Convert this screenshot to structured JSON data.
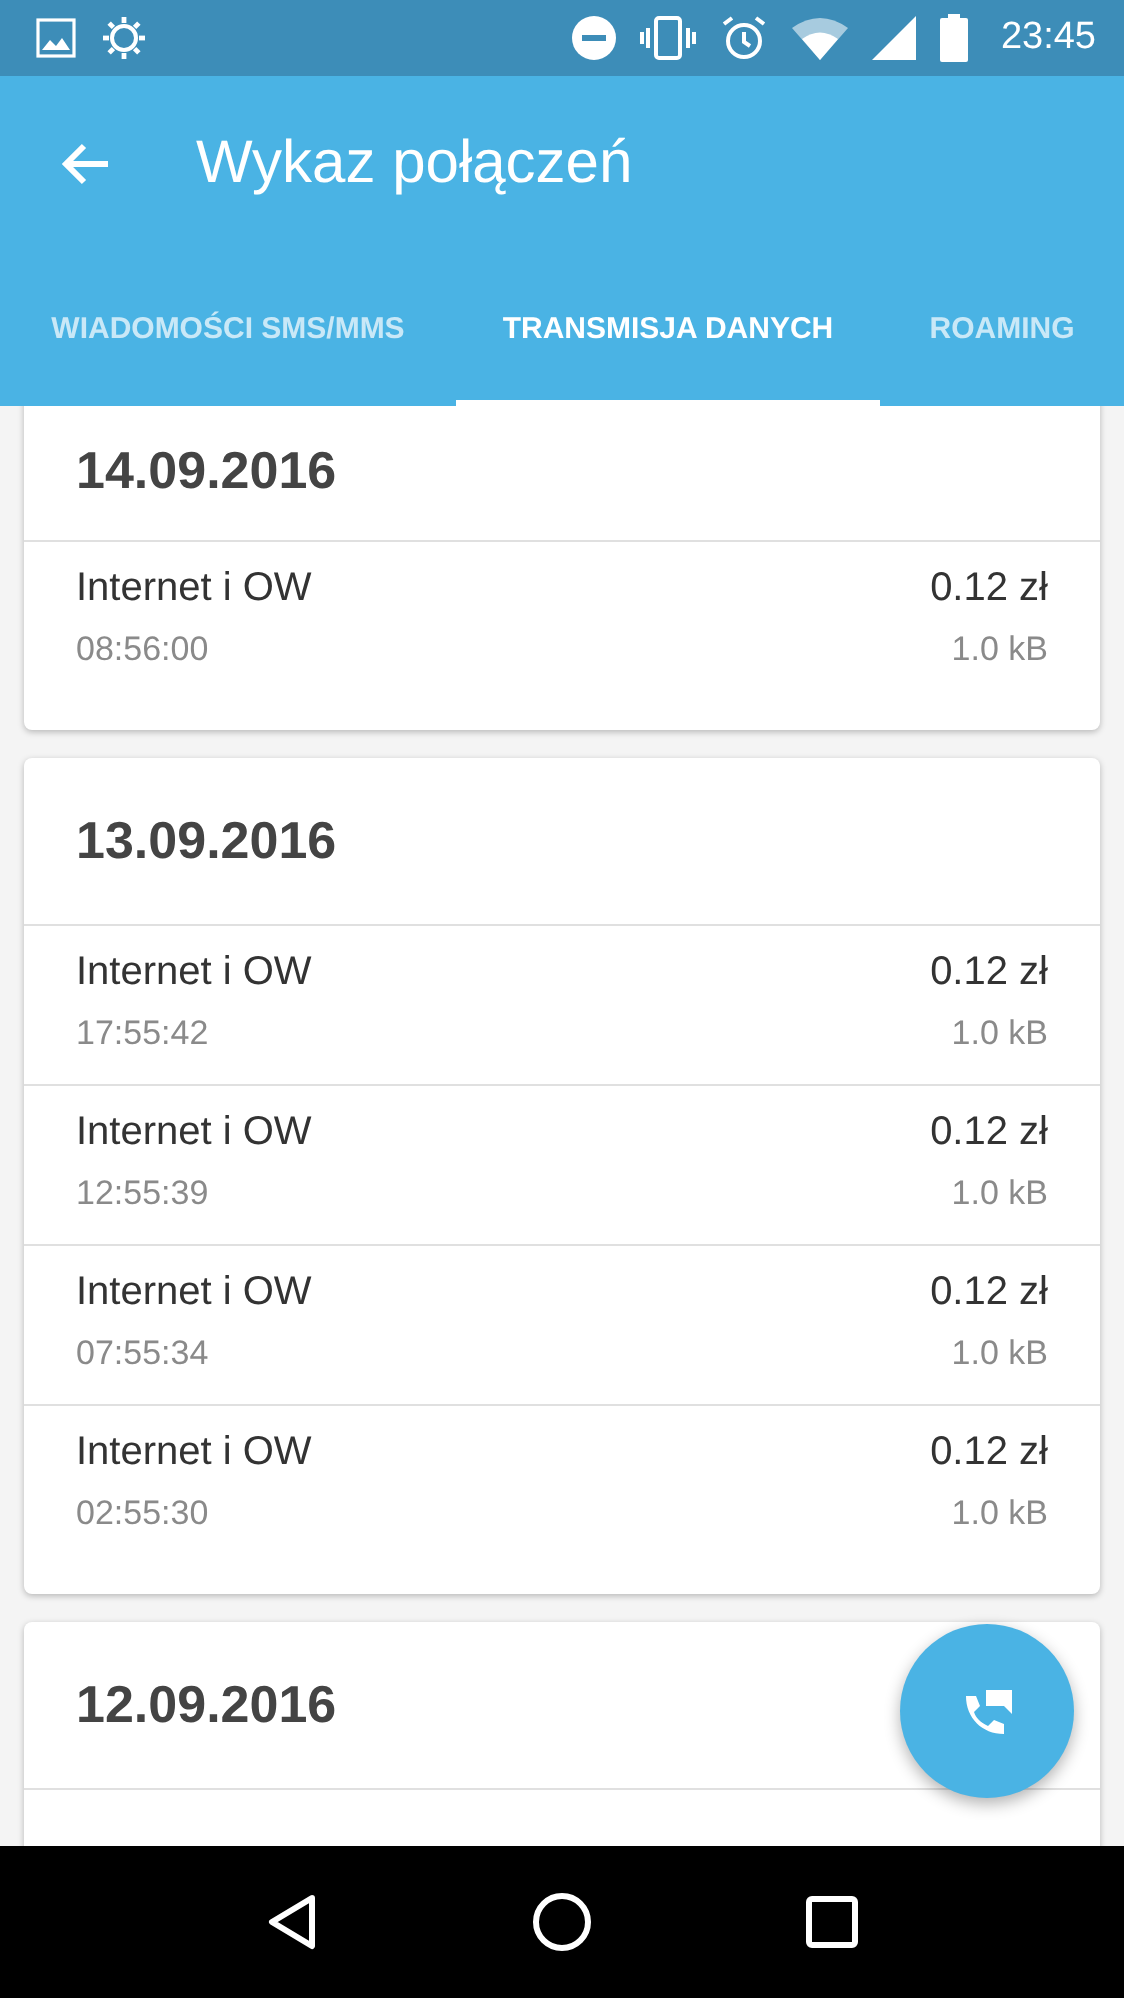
{
  "status_bar": {
    "time": "23:45"
  },
  "app_bar": {
    "title": "Wykaz połączeń"
  },
  "tabs": [
    {
      "label": "WIADOMOŚCI SMS/MMS",
      "selected": false
    },
    {
      "label": "TRANSMISJA DANYCH",
      "selected": true
    },
    {
      "label": "ROAMING",
      "selected": false
    }
  ],
  "days": [
    {
      "date": "14.09.2016",
      "entries": [
        {
          "name": "Internet i OW",
          "time": "08:56:00",
          "amount": "0.12 zł",
          "volume": "1.0 kB"
        }
      ]
    },
    {
      "date": "13.09.2016",
      "entries": [
        {
          "name": "Internet i OW",
          "time": "17:55:42",
          "amount": "0.12 zł",
          "volume": "1.0 kB"
        },
        {
          "name": "Internet i OW",
          "time": "12:55:39",
          "amount": "0.12 zł",
          "volume": "1.0 kB"
        },
        {
          "name": "Internet i OW",
          "time": "07:55:34",
          "amount": "0.12 zł",
          "volume": "1.0 kB"
        },
        {
          "name": "Internet i OW",
          "time": "02:55:30",
          "amount": "0.12 zł",
          "volume": "1.0 kB"
        }
      ]
    },
    {
      "date": "12.09.2016"
    }
  ]
}
